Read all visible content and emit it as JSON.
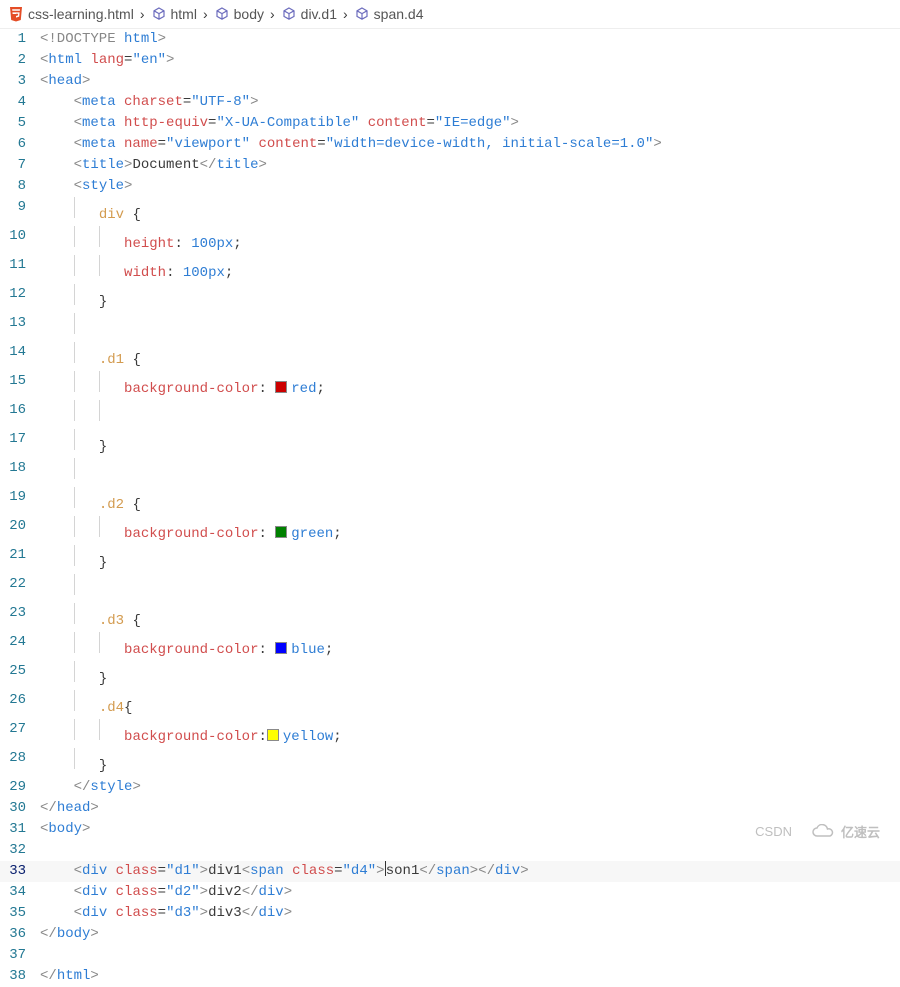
{
  "breadcrumb": [
    {
      "label": "css-learning.html",
      "icon": "html5"
    },
    {
      "label": "html",
      "icon": "cube"
    },
    {
      "label": "body",
      "icon": "cube"
    },
    {
      "label": "div.d1",
      "icon": "cube"
    },
    {
      "label": "span.d4",
      "icon": "cube"
    }
  ],
  "code": {
    "l1": {
      "doctype": "<!DOCTYPE",
      "word": "html",
      "close": ">"
    },
    "l2": {
      "tag": "html",
      "attr": "lang",
      "val": "\"en\""
    },
    "l3": {
      "tag": "head"
    },
    "l4": {
      "tag": "meta",
      "attr": "charset",
      "val": "\"UTF-8\""
    },
    "l5": {
      "tag": "meta",
      "attr1": "http-equiv",
      "val1": "\"X-UA-Compatible\"",
      "attr2": "content",
      "val2": "\"IE=edge\""
    },
    "l6": {
      "tag": "meta",
      "attr1": "name",
      "val1": "\"viewport\"",
      "attr2": "content",
      "val2": "\"width=device-width, initial-scale=1.0\""
    },
    "l7": {
      "open": "title",
      "text": "Document",
      "close": "title"
    },
    "l8": {
      "tag": "style"
    },
    "l9": {
      "sel": "div",
      "brace": "{"
    },
    "l10": {
      "prop": "height",
      "val": "100px"
    },
    "l11": {
      "prop": "width",
      "val": "100px"
    },
    "l12": {
      "brace": "}"
    },
    "l14": {
      "sel": ".d1",
      "brace": "{"
    },
    "l15": {
      "prop": "background-color",
      "val": "red",
      "swatch": "#cc0000"
    },
    "l17": {
      "brace": "}"
    },
    "l19": {
      "sel": ".d2",
      "brace": "{"
    },
    "l20": {
      "prop": "background-color",
      "val": "green",
      "swatch": "#008000"
    },
    "l21": {
      "brace": "}"
    },
    "l23": {
      "sel": ".d3",
      "brace": "{"
    },
    "l24": {
      "prop": "background-color",
      "val": "blue",
      "swatch": "#0000ff"
    },
    "l25": {
      "brace": "}"
    },
    "l26": {
      "sel": ".d4",
      "brace": "{"
    },
    "l27": {
      "prop": "background-color",
      "val": "yellow",
      "swatch": "#ffff00"
    },
    "l28": {
      "brace": "}"
    },
    "l29": {
      "close": "style"
    },
    "l30": {
      "close": "head"
    },
    "l31": {
      "open": "body"
    },
    "l33": {
      "tag1": "div",
      "attr1": "class",
      "val1": "\"d1\"",
      "text1": "div1",
      "tag2": "span",
      "attr2": "class",
      "val2": "\"d4\"",
      "text2": "son1"
    },
    "l34": {
      "tag": "div",
      "attr": "class",
      "val": "\"d2\"",
      "text": "div2"
    },
    "l35": {
      "tag": "div",
      "attr": "class",
      "val": "\"d3\"",
      "text": "div3"
    },
    "l36": {
      "close": "body"
    },
    "l38": {
      "close": "html"
    }
  },
  "active_line": 33,
  "watermark1": "CSDN",
  "watermark2": "亿速云"
}
